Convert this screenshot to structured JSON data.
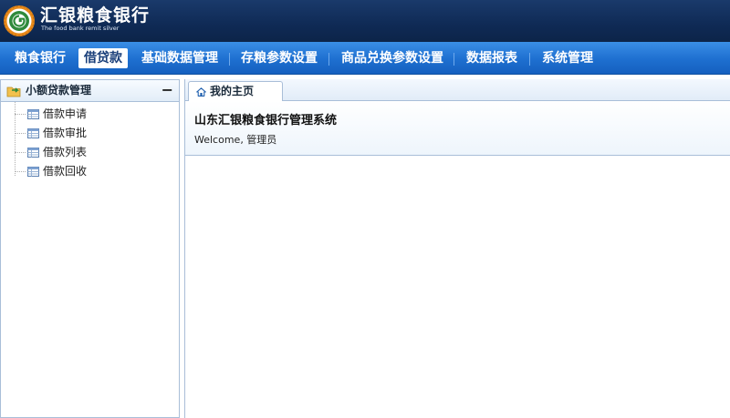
{
  "brand": {
    "title": "汇银粮食银行",
    "subtitle": "The food bank remit silver",
    "logo_icon": "bank-seal-logo"
  },
  "nav": {
    "items": [
      {
        "label": "粮食银行",
        "active": false
      },
      {
        "label": "借贷款",
        "active": true
      },
      {
        "label": "基础数据管理",
        "active": false
      },
      {
        "label": "存粮参数设置",
        "active": false
      },
      {
        "label": "商品兑换参数设置",
        "active": false
      },
      {
        "label": "数据报表",
        "active": false
      },
      {
        "label": "系统管理",
        "active": false
      }
    ]
  },
  "sidebar": {
    "title": "小额贷款管理",
    "collapse_label": "−",
    "items": [
      {
        "label": "借款申请",
        "icon": "table-icon"
      },
      {
        "label": "借款审批",
        "icon": "table-icon"
      },
      {
        "label": "借款列表",
        "icon": "table-icon"
      },
      {
        "label": "借款回收",
        "icon": "table-icon"
      }
    ]
  },
  "tabs": [
    {
      "label": "我的主页",
      "icon": "home-icon"
    }
  ],
  "main": {
    "title": "山东汇银粮食银行管理系统",
    "welcome": "Welcome, 管理员"
  },
  "colors": {
    "header_bg": "#0f2a55",
    "nav_bg": "#1e6fd0",
    "border": "#a9bed8"
  }
}
